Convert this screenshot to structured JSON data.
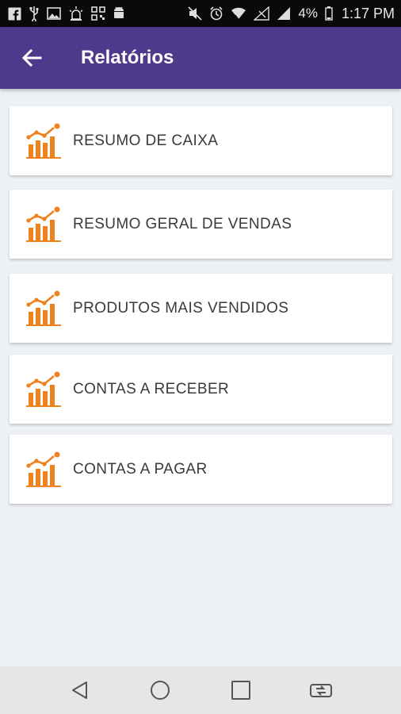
{
  "status_bar": {
    "battery_percent": "4%",
    "time": "1:17 PM",
    "icons_left": [
      "facebook-icon",
      "usb-icon",
      "image-icon",
      "alarm-light-icon",
      "qr-icon",
      "android-icon"
    ],
    "icons_right": [
      "mute-icon",
      "alarm-icon",
      "wifi-icon",
      "no-sim-icon",
      "signal-icon",
      "battery-icon"
    ]
  },
  "app_bar": {
    "title": "Relatórios",
    "background_color": "#4d3a8a"
  },
  "reports": [
    {
      "label": "RESUMO DE CAIXA",
      "icon": "bar-chart-icon"
    },
    {
      "label": "RESUMO GERAL DE VENDAS",
      "icon": "bar-chart-icon"
    },
    {
      "label": "PRODUTOS MAIS VENDIDOS",
      "icon": "bar-chart-icon"
    },
    {
      "label": "CONTAS A RECEBER",
      "icon": "bar-chart-icon"
    },
    {
      "label": "CONTAS A PAGAR",
      "icon": "bar-chart-icon"
    }
  ],
  "accent_color": "#f0821e",
  "nav_bar": {
    "buttons": [
      "back-nav-icon",
      "home-nav-icon",
      "recents-nav-icon",
      "switch-nav-icon"
    ]
  }
}
